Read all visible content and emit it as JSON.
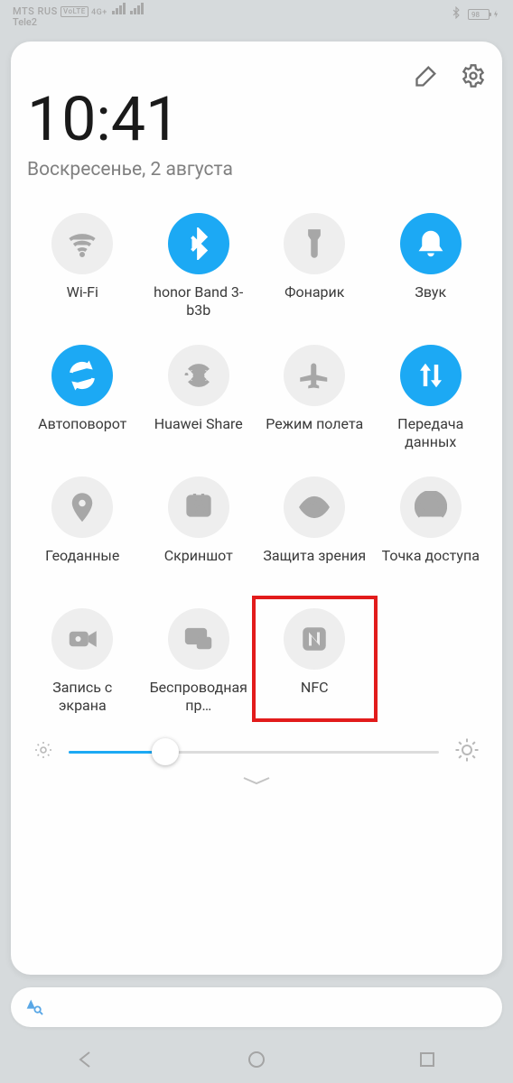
{
  "status": {
    "carrier1": "MTS RUS",
    "volte": "VoLTE",
    "net_badge": "4G+",
    "carrier2": "Tele2",
    "battery_pct": "98"
  },
  "clock": "10:41",
  "date": "Воскресенье, 2 августа",
  "tiles": [
    {
      "label": "Wi-Fi",
      "active": false,
      "icon": "wifi"
    },
    {
      "label": "honor Band 3-b3b",
      "active": true,
      "icon": "bluetooth"
    },
    {
      "label": "Фонарик",
      "active": false,
      "icon": "flashlight"
    },
    {
      "label": "Звук",
      "active": true,
      "icon": "bell"
    },
    {
      "label": "Автоповорот",
      "active": true,
      "icon": "rotate"
    },
    {
      "label": "Huawei Share",
      "active": false,
      "icon": "share"
    },
    {
      "label": "Режим полета",
      "active": false,
      "icon": "airplane"
    },
    {
      "label": "Передача данных",
      "active": true,
      "icon": "data"
    },
    {
      "label": "Геоданные",
      "active": false,
      "icon": "location"
    },
    {
      "label": "Скриншот",
      "active": false,
      "icon": "screenshot"
    },
    {
      "label": "Защита зрения",
      "active": false,
      "icon": "eye"
    },
    {
      "label": "Точка доступа",
      "active": false,
      "icon": "hotspot"
    },
    {
      "label": "Запись с экрана",
      "active": false,
      "icon": "record"
    },
    {
      "label": "Беспро­водная пр…",
      "active": false,
      "icon": "cast"
    },
    {
      "label": "NFC",
      "active": false,
      "icon": "nfc",
      "highlight": true
    }
  ],
  "brightness_pct": 26
}
